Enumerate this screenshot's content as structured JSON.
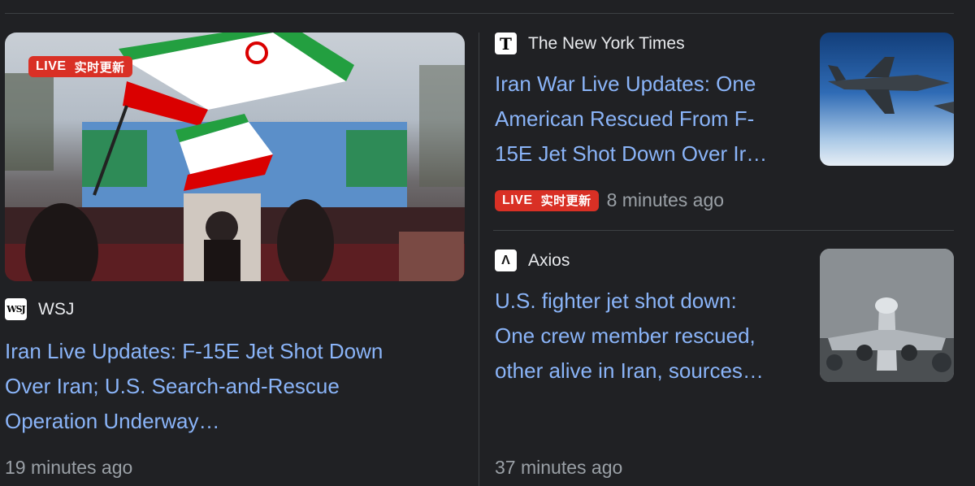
{
  "left_story": {
    "live_label": "LIVE",
    "live_label_zh": "实时更新",
    "source": "WSJ",
    "source_logo_text": "WSJ",
    "headline_lines": [
      "Iran Live Updates: F-15E Jet Shot Down",
      "Over Iran; U.S. Search-and-Rescue",
      "Operation Underway…"
    ],
    "time": "19 minutes ago"
  },
  "right_story_1": {
    "source": "The New York Times",
    "source_logo_text": "T",
    "headline_lines": [
      "Iran War Live Updates: One",
      "American Rescued From F-",
      "15E Jet Shot Down Over Ir…"
    ],
    "live_label": "LIVE",
    "live_label_zh": "实时更新",
    "time": "8 minutes ago"
  },
  "right_story_2": {
    "source": "Axios",
    "source_logo_text": "Λ",
    "headline_lines": [
      "U.S. fighter jet shot down:",
      "One crew member rescued,",
      "other alive in Iran, sources…"
    ],
    "time": "37 minutes ago"
  },
  "colors": {
    "background": "#202124",
    "headline": "#8ab4f8",
    "live_badge": "#d93025",
    "meta_text": "#9aa0a6"
  }
}
